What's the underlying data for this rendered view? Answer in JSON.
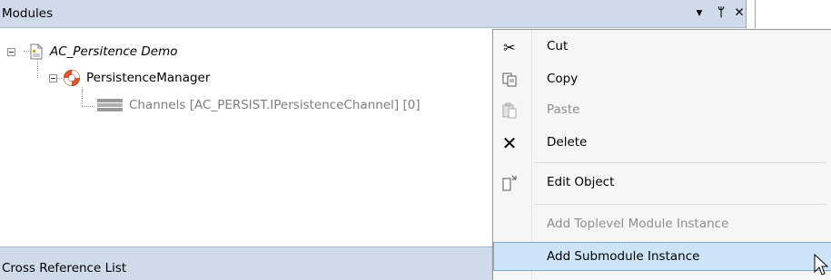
{
  "modules_panel": {
    "title": "Modules",
    "controls": {
      "dropdown": "▾",
      "pin": "ᛘ",
      "close": "✕"
    }
  },
  "tree": {
    "root": {
      "label": "AC_Persitence Demo"
    },
    "child": {
      "label": "PersistenceManager"
    },
    "leaf": {
      "label": "Channels [AC_PERSIST.IPersistenceChannel] [0]"
    }
  },
  "crossref_panel": {
    "title": "Cross Reference List"
  },
  "context_menu": {
    "items": [
      {
        "label": "Cut",
        "icon": "scissors-icon"
      },
      {
        "label": "Copy",
        "icon": "copy-icon"
      },
      {
        "label": "Paste",
        "icon": "paste-icon",
        "disabled": true
      },
      {
        "label": "Delete",
        "icon": "delete-icon"
      },
      {
        "label": "Edit Object",
        "icon": "edit-object-icon"
      },
      {
        "label": "Add Toplevel Module Instance",
        "disabled": true
      },
      {
        "label": "Add Submodule Instance",
        "highlighted": true
      }
    ]
  }
}
